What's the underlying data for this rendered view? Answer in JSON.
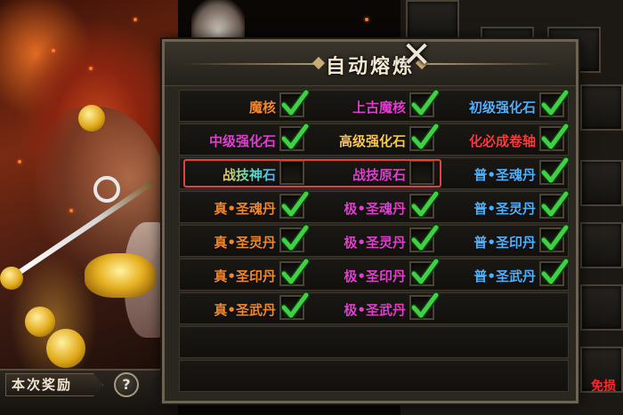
{
  "dialog": {
    "title": "自动熔炼",
    "close_icon": "close-x-icon"
  },
  "colors": {
    "orange": "#f2882c",
    "magenta": "#e23fd0",
    "blue": "#4fb0ff",
    "red": "#ff3a3a",
    "yellow": "#f6c84a",
    "check": "#35c43a"
  },
  "rows": [
    [
      {
        "label": "魔核",
        "color": "orange",
        "checked": true
      },
      {
        "label": "上古魔核",
        "color": "magenta",
        "checked": true
      },
      {
        "label": "初级强化石",
        "color": "blue",
        "checked": true
      }
    ],
    [
      {
        "label": "中级强化石",
        "color": "magenta",
        "checked": true
      },
      {
        "label": "高级强化石",
        "color": "yellow",
        "checked": true
      },
      {
        "label": "化必成卷轴",
        "color": "red",
        "checked": true
      }
    ],
    [
      {
        "label": "战技神石",
        "color": "gradient",
        "checked": false
      },
      {
        "label": "战技原石",
        "color": "magenta",
        "checked": false
      },
      {
        "label": "普•圣魂丹",
        "color": "blue",
        "checked": true
      }
    ],
    [
      {
        "label": "真•圣魂丹",
        "color": "orange",
        "checked": true
      },
      {
        "label": "极•圣魂丹",
        "color": "magenta",
        "checked": true
      },
      {
        "label": "普•圣灵丹",
        "color": "blue",
        "checked": true
      }
    ],
    [
      {
        "label": "真•圣灵丹",
        "color": "orange",
        "checked": true
      },
      {
        "label": "极•圣灵丹",
        "color": "magenta",
        "checked": true
      },
      {
        "label": "普•圣印丹",
        "color": "blue",
        "checked": true
      }
    ],
    [
      {
        "label": "真•圣印丹",
        "color": "orange",
        "checked": true
      },
      {
        "label": "极•圣印丹",
        "color": "magenta",
        "checked": true
      },
      {
        "label": "普•圣武丹",
        "color": "blue",
        "checked": true
      }
    ],
    [
      {
        "label": "真•圣武丹",
        "color": "orange",
        "checked": true
      },
      {
        "label": "极•圣武丹",
        "color": "magenta",
        "checked": true
      }
    ],
    [],
    []
  ],
  "reward": {
    "label": "本次奖励",
    "help_label": "?"
  },
  "footer": {
    "loss_text": "免损"
  }
}
